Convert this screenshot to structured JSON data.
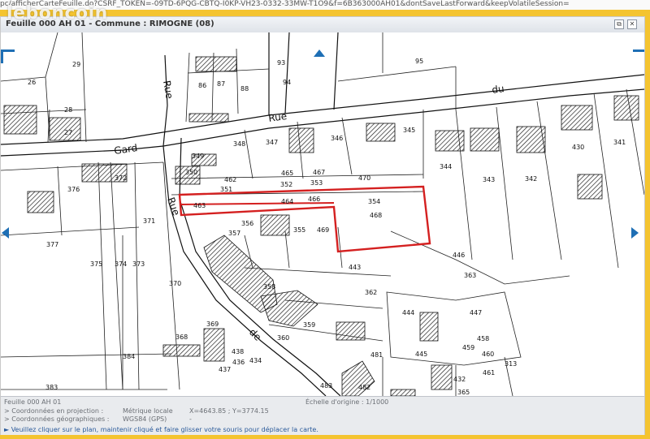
{
  "browser": {
    "url_fragment": "pc/afficherCarteFeuille.do?CSRF_TOKEN=-09TD-6PQG-CBTQ-I0KP-VH23-0332-33MW-T1O9&f=6B363000AH01&dontSaveLastForward&keepVolatileSession="
  },
  "watermark": "leboncoin",
  "window": {
    "title": "Feuille 000 AH 01 - Commune : RIMOGNE (08)",
    "restore_label": "⧉",
    "close_label": "✕"
  },
  "map": {
    "streets": {
      "rue_top": "Rue",
      "du": "du",
      "rue_left": "Rue",
      "gard": "Gard",
      "rue_diag": "Rue",
      "de": "de"
    },
    "parcels": [
      "26",
      "29",
      "93",
      "95",
      "86",
      "87",
      "88",
      "94",
      "28",
      "27",
      "345",
      "346",
      "347",
      "348",
      "349",
      "430",
      "341",
      "350",
      "376",
      "372",
      "462",
      "465",
      "467",
      "470",
      "344",
      "343",
      "342",
      "351",
      "352",
      "353",
      "371",
      "463",
      "464",
      "466",
      "354",
      "468",
      "356",
      "355",
      "469",
      "377",
      "375",
      "374",
      "373",
      "357",
      "443",
      "446",
      "363",
      "370",
      "358",
      "362",
      "444",
      "447",
      "369",
      "359",
      "368",
      "360",
      "458",
      "459",
      "460",
      "384",
      "438",
      "436",
      "434",
      "481",
      "445",
      "461",
      "437",
      "432",
      "313",
      "383",
      "483",
      "482",
      "365"
    ],
    "highlight_color": "#d42020"
  },
  "info": {
    "feuille": "Feuille 000 AH 01",
    "proj_label": "> Coordonnées en projection :",
    "geo_label": "> Coordonnées géographiques :",
    "metric": "Métrique locale",
    "wgs": "WGS84 (GPS)",
    "coords": "X=4643.85 ; Y=3774.15",
    "dash": "-",
    "scale": "Échelle d'origine : 1/1000",
    "hint": "► Veuillez cliquer sur le plan, maintenir cliqué et faire glisser votre souris pour déplacer la carte."
  }
}
